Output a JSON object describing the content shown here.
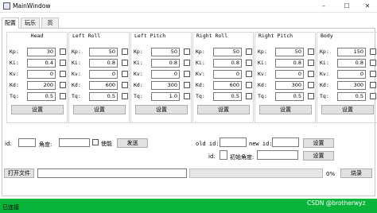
{
  "window": {
    "title": "MainWindow",
    "minimize": "–",
    "maximize": "☐",
    "close": "✕"
  },
  "tabs": [
    {
      "label": "配置"
    },
    {
      "label": "玩乐"
    },
    {
      "label": "页"
    }
  ],
  "groups": [
    {
      "title": "Head",
      "rows": [
        {
          "label": "Kp:",
          "value": "30"
        },
        {
          "label": "Ki:",
          "value": "0.4"
        },
        {
          "label": "Kv:",
          "value": "0"
        },
        {
          "label": "Kd:",
          "value": "200"
        },
        {
          "label": "Tq:",
          "value": "0.5"
        }
      ],
      "button": "设置"
    },
    {
      "title": "Left Roll",
      "rows": [
        {
          "label": "Kp:",
          "value": "50"
        },
        {
          "label": "Ki:",
          "value": "0.8"
        },
        {
          "label": "Kv:",
          "value": "0"
        },
        {
          "label": "Kd:",
          "value": "600"
        },
        {
          "label": "Tq:",
          "value": "0.5"
        }
      ],
      "button": "设置"
    },
    {
      "title": "Left Pitch",
      "rows": [
        {
          "label": "Kp:",
          "value": "50"
        },
        {
          "label": "Ki:",
          "value": "0.8"
        },
        {
          "label": "Kv:",
          "value": "0"
        },
        {
          "label": "Kd:",
          "value": "300"
        },
        {
          "label": "Tq:",
          "value": "1.0"
        }
      ],
      "button": "设置"
    },
    {
      "title": "Right Roll",
      "rows": [
        {
          "label": "Kp:",
          "value": "50"
        },
        {
          "label": "Ki:",
          "value": "0.8"
        },
        {
          "label": "Kv:",
          "value": "0"
        },
        {
          "label": "Kd:",
          "value": "600"
        },
        {
          "label": "Tq:",
          "value": "0.5"
        }
      ],
      "button": "设置"
    },
    {
      "title": "Right Pitch",
      "rows": [
        {
          "label": "Kp:",
          "value": "50"
        },
        {
          "label": "Ki:",
          "value": "0.8"
        },
        {
          "label": "Kv:",
          "value": "0"
        },
        {
          "label": "Kd:",
          "value": "300"
        },
        {
          "label": "Tq:",
          "value": "0.5"
        }
      ],
      "button": "设置"
    },
    {
      "title": "Body",
      "rows": [
        {
          "label": "Kp:",
          "value": "150"
        },
        {
          "label": "Ki:",
          "value": "0.8"
        },
        {
          "label": "Kv:",
          "value": "0"
        },
        {
          "label": "Kd:",
          "value": "300"
        },
        {
          "label": "Tq:",
          "value": "0.5"
        }
      ],
      "button": "设置"
    }
  ],
  "control": {
    "id_label": "id:",
    "id_value": "",
    "angle_label": "角度:",
    "angle_value": "",
    "enable_label": "使能",
    "send_button": "发送",
    "old_id_label": "old id:",
    "old_id_value": "",
    "new_id_label": "new id:",
    "new_id_value": "",
    "set_id_button": "设置",
    "id2_label": "id:",
    "id2_value": "",
    "init_angle_label": "初始角度:",
    "init_angle_value": "",
    "set_init_button": "设置"
  },
  "file": {
    "open_button": "打开文件",
    "path_value": "",
    "progress_percent": 0,
    "progress_label": "0%",
    "burn_button": "烧录"
  },
  "status": {
    "text": "已连接",
    "color": "#09b43a"
  },
  "watermark": "CSDN @brotherwyz"
}
